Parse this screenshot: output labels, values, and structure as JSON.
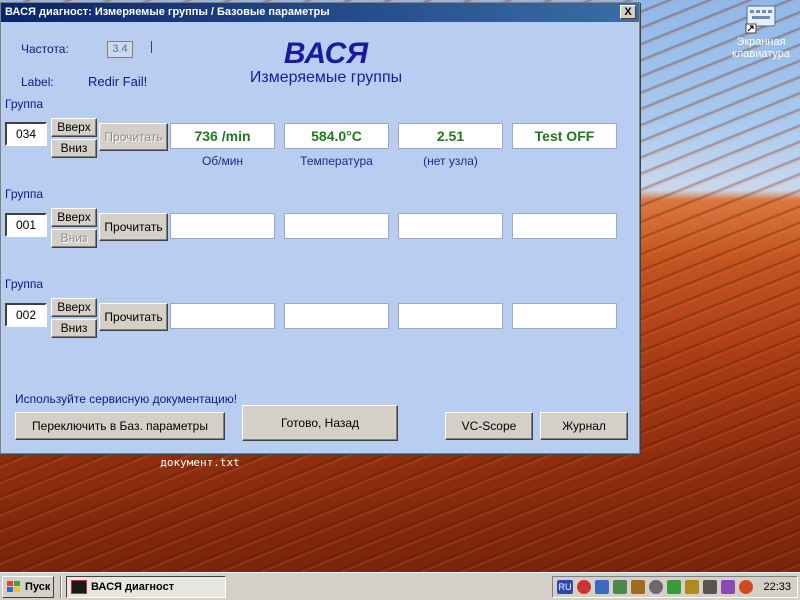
{
  "window": {
    "title": "ВАСЯ диагност: Измеряемые группы / Базовые параметры",
    "close_label": "X"
  },
  "header": {
    "freq_label": "Частота:",
    "freq_value": "3.4",
    "label_key": "Label:",
    "label_value": "Redir Fail!",
    "app_title": "ВАСЯ",
    "app_subtitle": "Измеряемые группы"
  },
  "groups": [
    {
      "caption": "Группа",
      "number": "034",
      "up_label": "Вверх",
      "down_label": "Вниз",
      "read_label": "Прочитать",
      "fields": [
        "736 /min",
        "584.0°C",
        "2.51",
        "Test OFF"
      ],
      "units": [
        "Об/мин",
        "Температура",
        "(нет узла)",
        ""
      ]
    },
    {
      "caption": "Группа",
      "number": "001",
      "up_label": "Вверх",
      "down_label": "Вниз",
      "read_label": "Прочитать",
      "fields": [
        "",
        "",
        "",
        ""
      ],
      "units": [
        "",
        "",
        "",
        ""
      ]
    },
    {
      "caption": "Группа",
      "number": "002",
      "up_label": "Вверх",
      "down_label": "Вниз",
      "read_label": "Прочитать",
      "fields": [
        "",
        "",
        "",
        ""
      ],
      "units": [
        "",
        "",
        "",
        ""
      ]
    }
  ],
  "footer": {
    "hint": "Используйте сервисную документацию!",
    "switch_label": "Переключить в Баз. параметры",
    "done_label": "Готово, Назад",
    "vcscope_label": "VC-Scope",
    "journal_label": "Журнал"
  },
  "desktop": {
    "keyboard_icon_label": "Экранная клавиатура",
    "doc_label": "документ.txt"
  },
  "taskbar": {
    "start_label": "Пуск",
    "task_label": "ВАСЯ диагност",
    "tray_lang": "RU",
    "clock": "22:33"
  },
  "colors": {
    "window_bg": "#b9cdf0",
    "value_green": "#1f7a1f",
    "title_blue": "#1a1aa0"
  }
}
